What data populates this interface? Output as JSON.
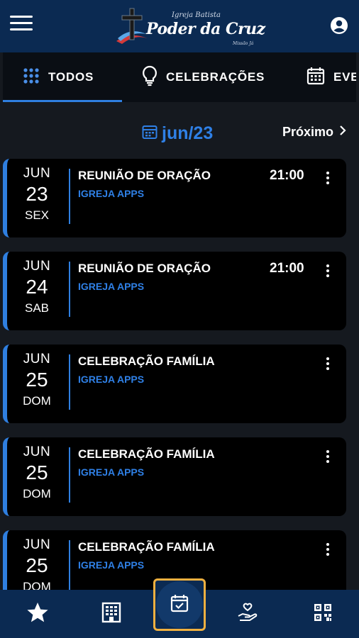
{
  "header": {
    "logo_tag": "Igreja Batista",
    "logo_name": "Poder da Cruz",
    "logo_small": "Missão Já"
  },
  "tabs": [
    {
      "label": "TODOS",
      "icon": "grid-icon",
      "active": true
    },
    {
      "label": "CELEBRAÇÕES",
      "icon": "lightbulb-icon",
      "active": false
    },
    {
      "label": "EVE",
      "icon": "calendar-icon",
      "active": false
    }
  ],
  "month": {
    "label": "jun/23",
    "next_label": "Próximo"
  },
  "events": [
    {
      "month": "JUN",
      "day": "23",
      "weekday": "SEX",
      "title": "REUNIÃO DE ORAÇÃO",
      "subtitle": "IGREJA APPS",
      "time": "21:00"
    },
    {
      "month": "JUN",
      "day": "24",
      "weekday": "SAB",
      "title": "REUNIÃO DE ORAÇÃO",
      "subtitle": "IGREJA APPS",
      "time": "21:00"
    },
    {
      "month": "JUN",
      "day": "25",
      "weekday": "DOM",
      "title": "CELEBRAÇÃO FAMÍLIA",
      "subtitle": "IGREJA APPS",
      "time": ""
    },
    {
      "month": "JUN",
      "day": "25",
      "weekday": "DOM",
      "title": "CELEBRAÇÃO FAMÍLIA",
      "subtitle": "IGREJA APPS",
      "time": ""
    },
    {
      "month": "JUN",
      "day": "25",
      "weekday": "DOM",
      "title": "CELEBRAÇÃO FAMÍLIA",
      "subtitle": "IGREJA APPS",
      "time": ""
    }
  ],
  "bottom_nav": [
    {
      "icon": "star-icon",
      "active": false
    },
    {
      "icon": "building-icon",
      "active": false
    },
    {
      "icon": "calendar-check-icon",
      "active": true
    },
    {
      "icon": "hand-heart-icon",
      "active": false
    },
    {
      "icon": "qr-code-icon",
      "active": false
    }
  ],
  "colors": {
    "header_bg": "#0b2a52",
    "page_bg": "#15191f",
    "card_bg": "#000000",
    "accent": "#2f7fe0",
    "active_outline": "#f0b040"
  }
}
